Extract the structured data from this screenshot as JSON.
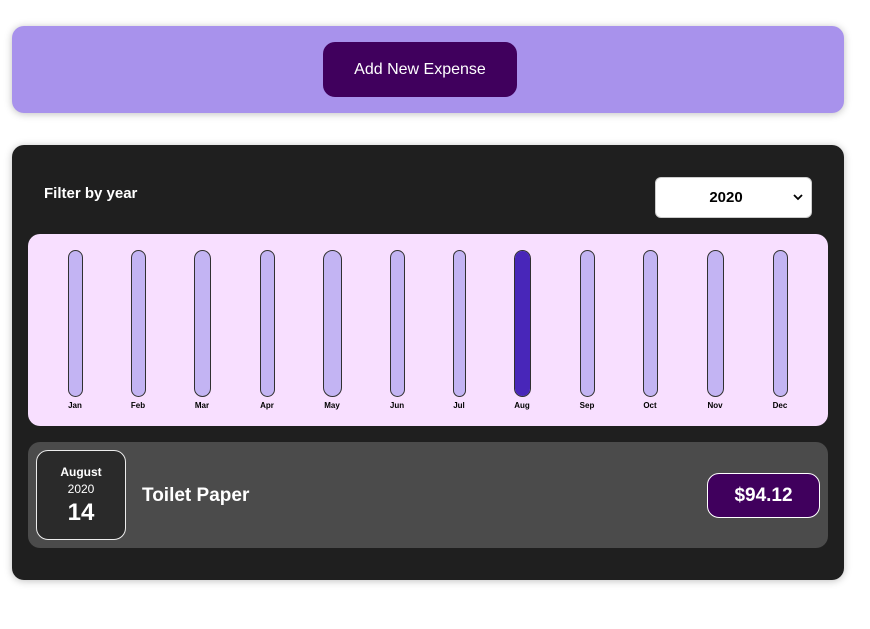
{
  "new_expense": {
    "add_button_label": "Add New Expense",
    "panel_color": "#a892ec",
    "button_color": "#40005d"
  },
  "filter": {
    "label": "Filter by year",
    "selected_year": "2020"
  },
  "chart": {
    "bar_fill_color": "#4826b9",
    "bar_empty_color": "#c3b4f3",
    "background": "#f8dfff",
    "months": [
      {
        "label": "Jan",
        "fill": 0
      },
      {
        "label": "Feb",
        "fill": 0
      },
      {
        "label": "Mar",
        "fill": 0
      },
      {
        "label": "Apr",
        "fill": 0
      },
      {
        "label": "May",
        "fill": 0
      },
      {
        "label": "Jun",
        "fill": 0
      },
      {
        "label": "Jul",
        "fill": 0
      },
      {
        "label": "Aug",
        "fill": 1
      },
      {
        "label": "Sep",
        "fill": 0
      },
      {
        "label": "Oct",
        "fill": 0
      },
      {
        "label": "Nov",
        "fill": 0
      },
      {
        "label": "Dec",
        "fill": 0
      }
    ]
  },
  "expense_item": {
    "month": "August",
    "year": "2020",
    "day": "14",
    "title": "Toilet Paper",
    "amount": "$94.12"
  }
}
